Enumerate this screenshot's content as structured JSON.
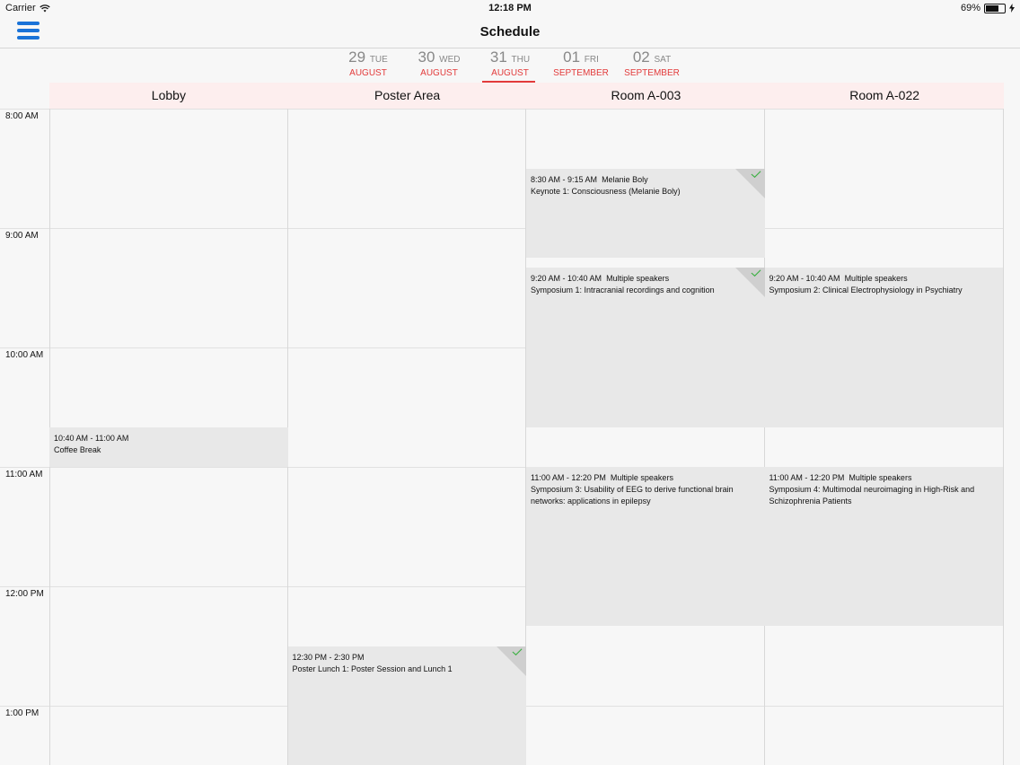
{
  "status_bar": {
    "carrier": "Carrier",
    "time": "12:18 PM",
    "battery": "69%",
    "battery_level": 0.69
  },
  "nav": {
    "title": "Schedule"
  },
  "dates": [
    {
      "day": "29",
      "dow": "TUE",
      "month": "AUGUST",
      "selected": false
    },
    {
      "day": "30",
      "dow": "WED",
      "month": "AUGUST",
      "selected": false
    },
    {
      "day": "31",
      "dow": "THU",
      "month": "AUGUST",
      "selected": true
    },
    {
      "day": "01",
      "dow": "FRI",
      "month": "SEPTEMBER",
      "selected": false
    },
    {
      "day": "02",
      "dow": "SAT",
      "month": "SEPTEMBER",
      "selected": false
    }
  ],
  "rooms": [
    "Lobby",
    "Poster Area",
    "Room A-003",
    "Room A-022"
  ],
  "hours": [
    "8:00 AM",
    "9:00 AM",
    "10:00 AM",
    "11:00 AM",
    "12:00 PM",
    "1:00 PM"
  ],
  "events": [
    {
      "room": 0,
      "start": 10.6667,
      "end": 11.0,
      "time": "10:40 AM - 11:00 AM",
      "speaker": "",
      "title": "Coffee Break",
      "checked": false
    },
    {
      "room": 1,
      "start": 12.5,
      "end": 14.5,
      "time": "12:30 PM - 2:30 PM",
      "speaker": "",
      "title": "Poster Lunch 1: Poster Session and Lunch 1",
      "checked": true
    },
    {
      "room": 2,
      "start": 8.5,
      "end": 9.25,
      "time": "8:30 AM - 9:15 AM",
      "speaker": "Melanie Boly",
      "title": "Keynote 1: Consciousness (Melanie Boly)",
      "checked": true
    },
    {
      "room": 2,
      "start": 9.3333,
      "end": 10.6667,
      "time": "9:20 AM - 10:40 AM",
      "speaker": "Multiple speakers",
      "title": "Symposium 1: Intracranial recordings and cognition",
      "checked": true
    },
    {
      "room": 2,
      "start": 11.0,
      "end": 12.3333,
      "time": "11:00 AM - 12:20 PM",
      "speaker": "Multiple speakers",
      "title": "Symposium 3: Usability of EEG to derive functional brain networks: applications in epilepsy",
      "checked": false
    },
    {
      "room": 3,
      "start": 9.3333,
      "end": 10.6667,
      "time": "9:20 AM - 10:40 AM",
      "speaker": "Multiple speakers",
      "title": "Symposium 2: Clinical Electrophysiology in Psychiatry",
      "checked": false
    },
    {
      "room": 3,
      "start": 11.0,
      "end": 12.3333,
      "time": "11:00 AM - 12:20 PM",
      "speaker": "Multiple speakers",
      "title": "Symposium 4: Multimodal neuroimaging in High-Risk and Schizophrenia Patients",
      "checked": false
    }
  ],
  "colors": {
    "accent_red": "#e23b3b",
    "menu_blue": "#1a73d8",
    "check_green": "#3cb043",
    "event_bg": "#e8e8e8",
    "header_bg": "#fdeeee"
  }
}
